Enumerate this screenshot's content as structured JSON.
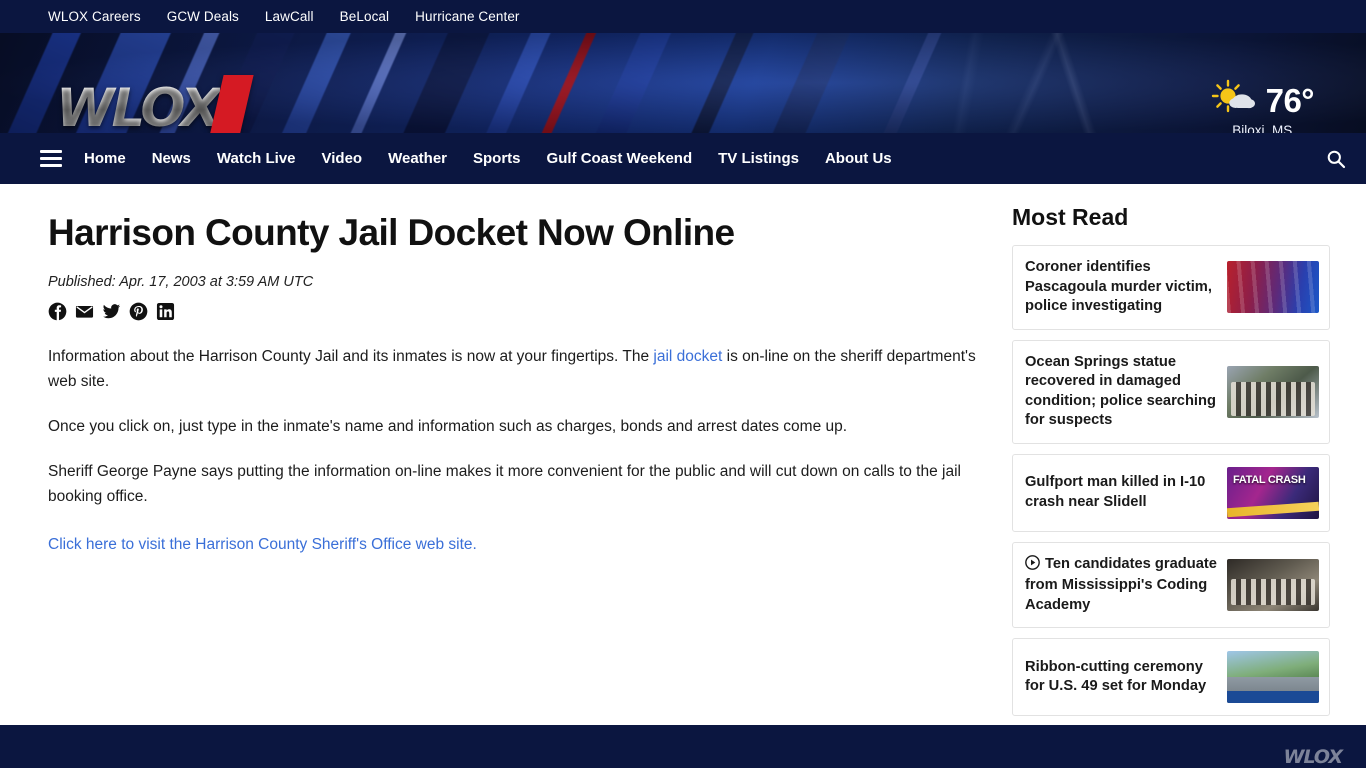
{
  "utility_nav": {
    "items": [
      {
        "label": "WLOX Careers"
      },
      {
        "label": "GCW Deals"
      },
      {
        "label": "LawCall"
      },
      {
        "label": "BeLocal"
      },
      {
        "label": "Hurricane Center"
      }
    ]
  },
  "masthead": {
    "logo_text": "WLOX",
    "logo_icon": "wlox-logo",
    "accent_red": "#d51a23",
    "banner_blue": "#0e1c4c",
    "weather": {
      "icon": "sun-behind-cloud-icon",
      "temperature": "76°",
      "location": "Biloxi, MS"
    }
  },
  "main_nav": {
    "menu_icon": "hamburger-menu-icon",
    "search_icon": "search-icon",
    "items": [
      {
        "label": "Home"
      },
      {
        "label": "News"
      },
      {
        "label": "Watch Live"
      },
      {
        "label": "Video"
      },
      {
        "label": "Weather"
      },
      {
        "label": "Sports"
      },
      {
        "label": "Gulf Coast Weekend"
      },
      {
        "label": "TV Listings"
      },
      {
        "label": "About Us"
      }
    ]
  },
  "article": {
    "headline": "Harrison County Jail Docket Now Online",
    "byline": "Published: Apr. 17, 2003 at 3:59 AM UTC",
    "share": [
      {
        "name": "facebook-icon",
        "label": "Facebook"
      },
      {
        "name": "email-icon",
        "label": "Email"
      },
      {
        "name": "twitter-icon",
        "label": "Twitter"
      },
      {
        "name": "pinterest-icon",
        "label": "Pinterest"
      },
      {
        "name": "linkedin-icon",
        "label": "LinkedIn"
      }
    ],
    "paragraph_1_before": "Information about the Harrison County Jail and its inmates is now at your fingertips. The ",
    "paragraph_1_link": "jail docket",
    "paragraph_1_after": " is on-line on the sheriff department's web site.",
    "paragraph_2": "Once you click on, just type in the inmate's name and information such as charges, bonds and arrest dates come up.",
    "paragraph_3": "Sheriff George Payne says putting the information on-line makes it more convenient for the public and will cut down on calls to the jail booking office.",
    "closing_link": "Click here to visit the Harrison County Sheriff's Office web site.",
    "link_color": "#3a6fd8"
  },
  "sidebar": {
    "title": "Most Read",
    "items": [
      {
        "title": "Coroner identifies Pascagoula murder victim, police investigating",
        "thumb": "police-lights-thumbnail",
        "thumb_class": "th-police",
        "is_video": false
      },
      {
        "title": "Ocean Springs statue recovered in damaged condition; police searching for suspects",
        "thumb": "statue-thumbnail",
        "thumb_class": "th-statue",
        "is_video": false
      },
      {
        "title": "Gulfport man killed in I-10 crash near Slidell",
        "thumb": "fatal-crash-thumbnail",
        "thumb_class": "th-crash",
        "thumb_text": "FATAL CRASH",
        "is_video": false
      },
      {
        "title": "Ten candidates graduate from Mississippi's Coding Academy",
        "thumb": "graduates-thumbnail",
        "thumb_class": "th-grad",
        "is_video": true
      },
      {
        "title": "Ribbon-cutting ceremony for U.S. 49 set for Monday",
        "thumb": "highway-thumbnail",
        "thumb_class": "th-ribbon",
        "is_video": false
      }
    ]
  },
  "footer": {
    "logo_text": "WLOX"
  }
}
